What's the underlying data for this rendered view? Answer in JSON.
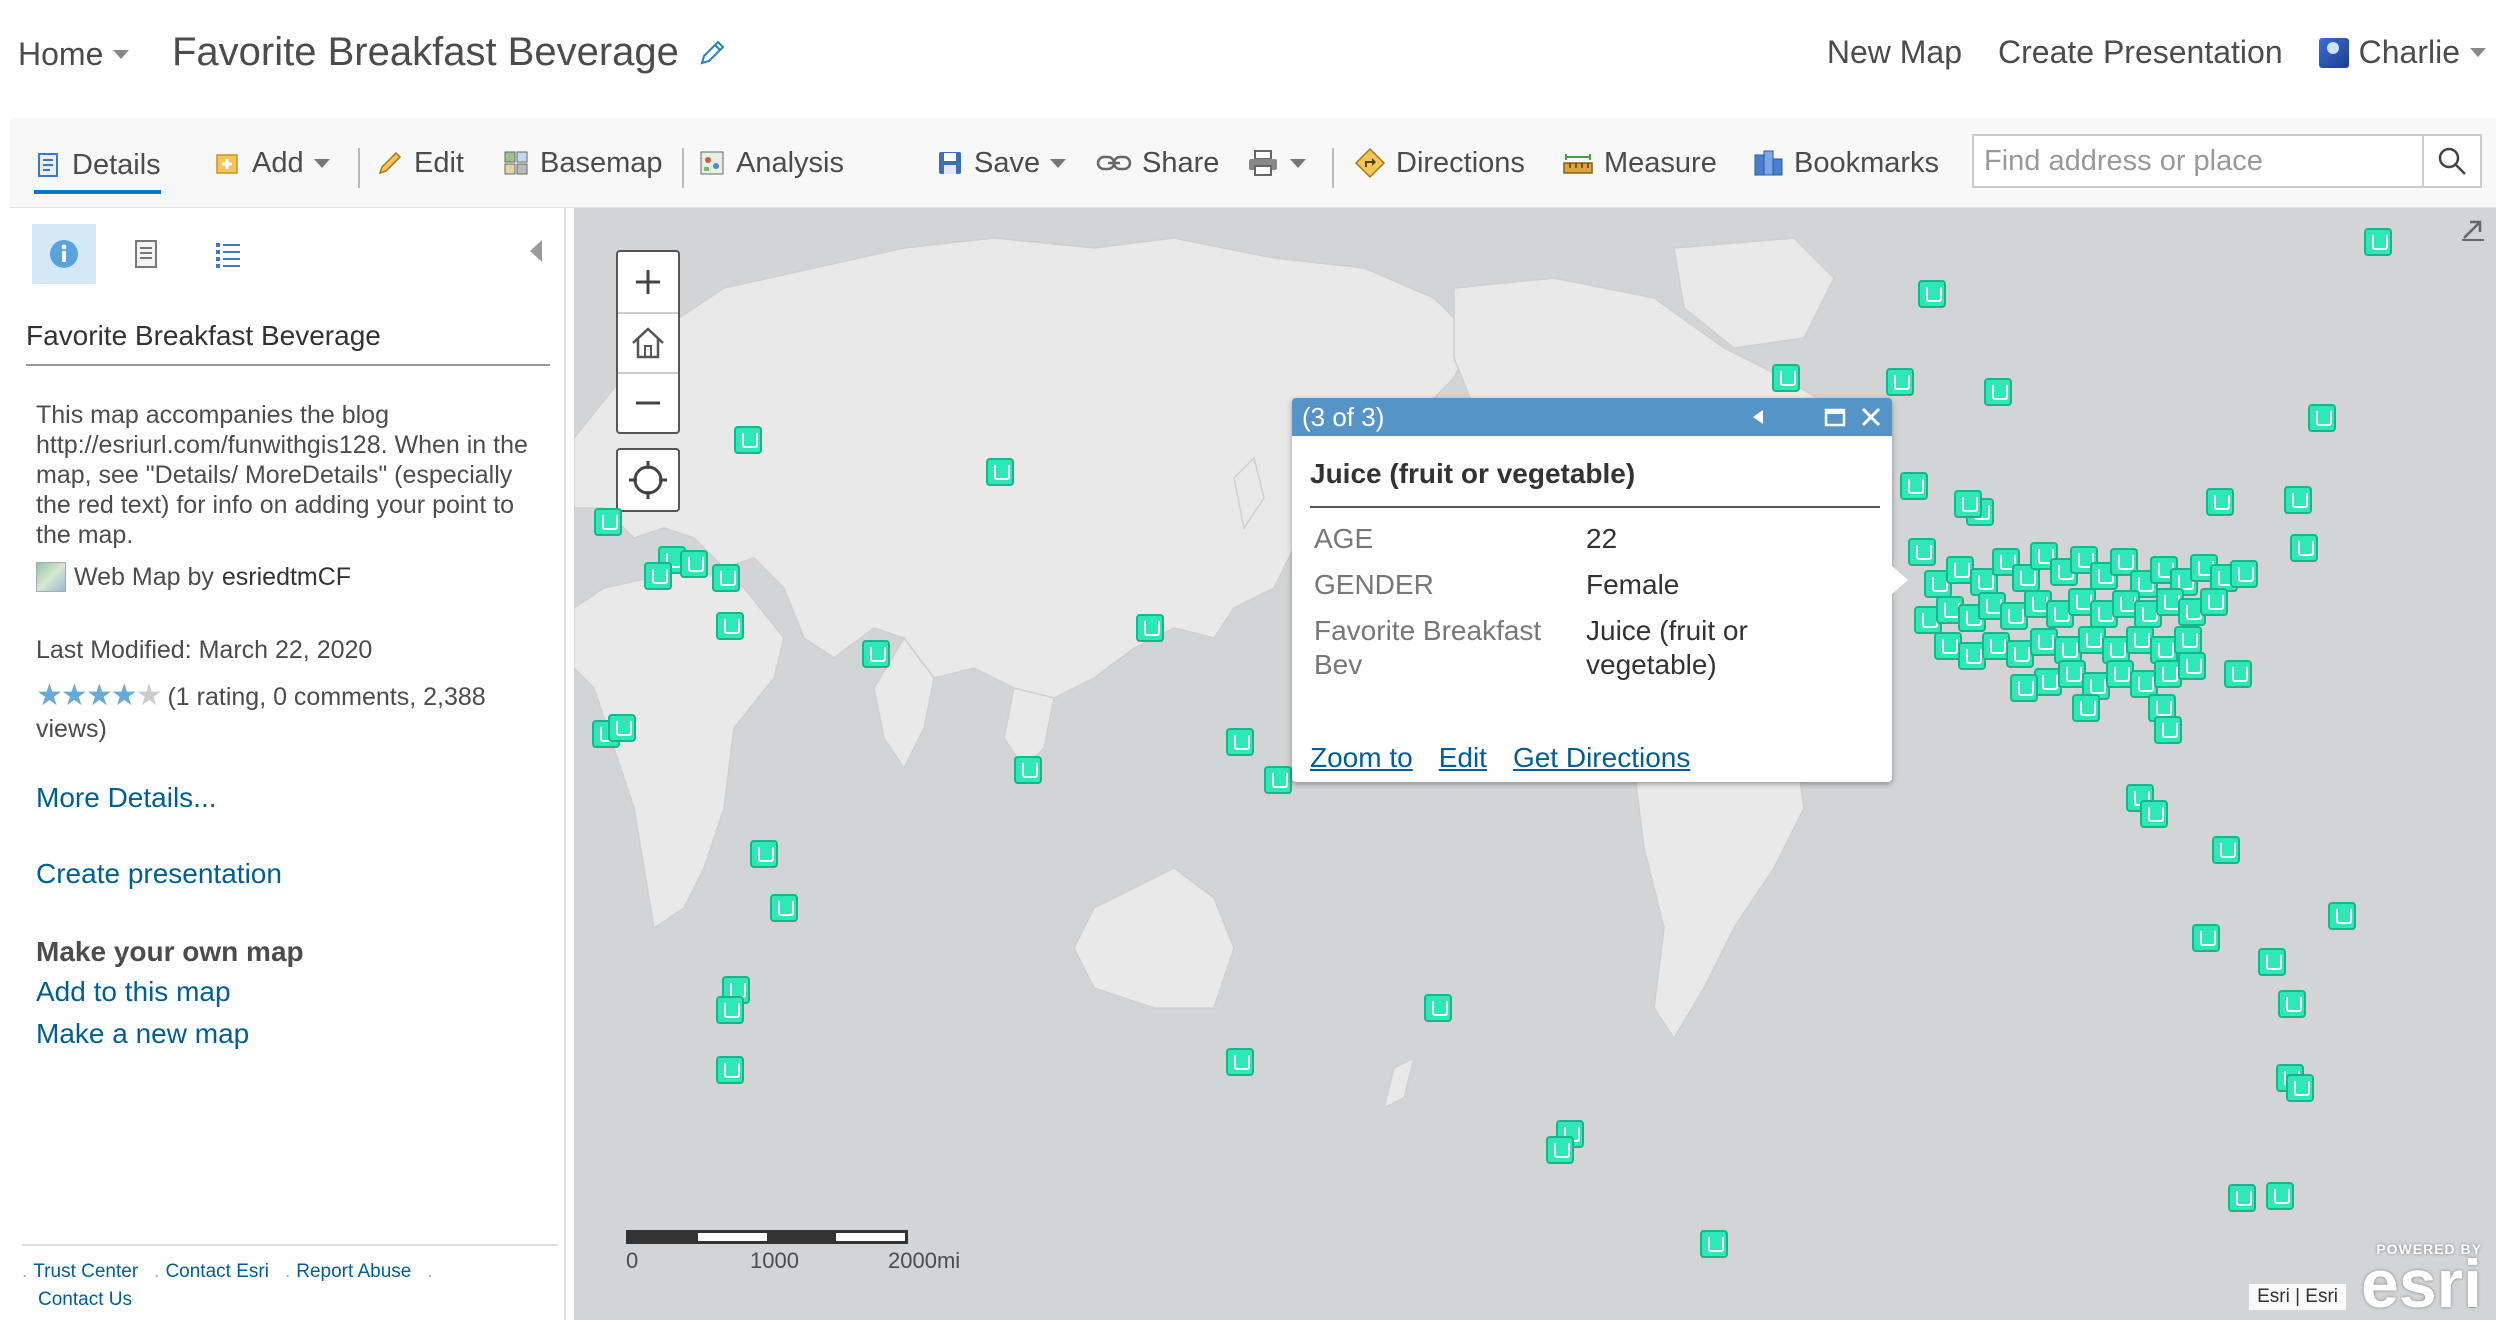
{
  "header": {
    "home_label": "Home",
    "map_title": "Favorite Breakfast Beverage",
    "new_map": "New Map",
    "create_presentation": "Create Presentation",
    "user_name": "Charlie"
  },
  "toolbar": {
    "details": "Details",
    "add": "Add",
    "edit": "Edit",
    "basemap": "Basemap",
    "analysis": "Analysis",
    "save": "Save",
    "share": "Share",
    "directions": "Directions",
    "measure": "Measure",
    "bookmarks": "Bookmarks",
    "search_placeholder": "Find address or place"
  },
  "panel": {
    "title": "Favorite Breakfast Beverage",
    "description": "This map accompanies the blog http://esriurl.com/funwithgis128. When in the map, see \"Details/ MoreDetails\" (especially the red text) for info on adding your point to the map.",
    "webmap_by": "Web Map by",
    "owner": "esriedtmCF",
    "last_modified": "Last Modified: March 22, 2020",
    "rating_stars": 4,
    "rating_text": "(1 rating, 0 comments, 2,388 views)",
    "more_details": "More Details...",
    "create_presentation": "Create presentation",
    "make_own_map": "Make your own map",
    "add_to_map": "Add to this map",
    "make_new_map": "Make a new map",
    "footer": {
      "trust_center": "Trust Center",
      "contact_esri": "Contact Esri",
      "report_abuse": "Report Abuse",
      "contact_us": "Contact Us"
    }
  },
  "popup": {
    "counter": "(3 of 3)",
    "title": "Juice (fruit or vegetable)",
    "attributes": [
      {
        "key": "AGE",
        "value": "22"
      },
      {
        "key": "GENDER",
        "value": "Female"
      },
      {
        "key": "Favorite Breakfast Bev",
        "value": "Juice (fruit or vegetable)"
      }
    ],
    "zoom_to": "Zoom to",
    "edit": "Edit",
    "get_directions": "Get Directions"
  },
  "map": {
    "scale_labels": [
      "0",
      "1000",
      "2000mi"
    ],
    "attribution": "Esri | Esri",
    "logo_powered_by": "POWERED BY",
    "logo_text": "esri",
    "marker_color": "#2ee8b6"
  },
  "colors": {
    "accent": "#0079c1",
    "link": "#005e95",
    "popup_header": "#5594c6",
    "map_water": "#d3d4d6",
    "map_land": "#e7e7e7"
  }
}
